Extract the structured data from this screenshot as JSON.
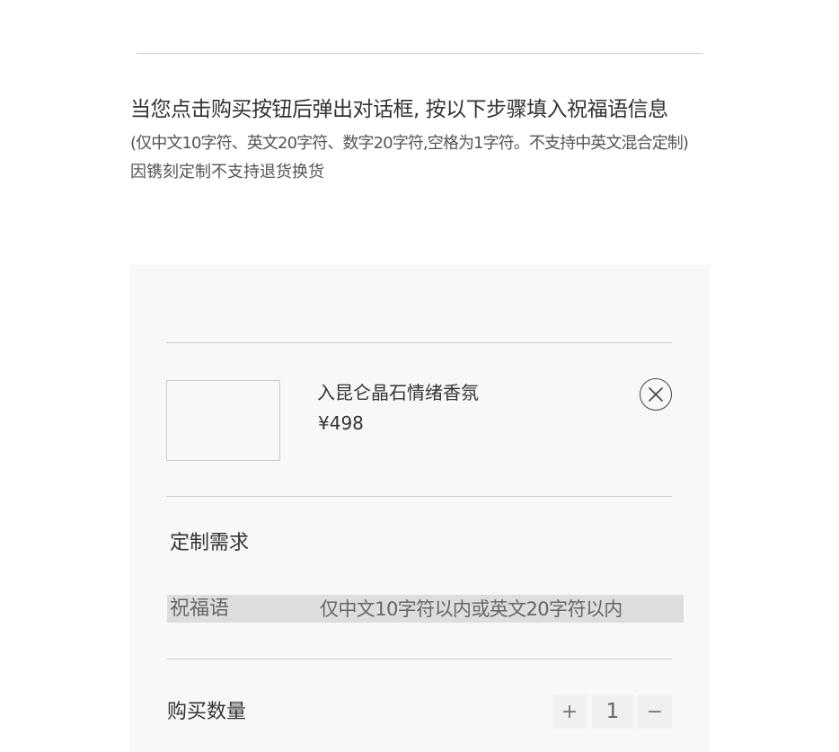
{
  "intro": {
    "title": "当您点击购买按钮后弹出对话框, 按以下步骤填入祝福语信息",
    "note": "(仅中文10字符、英文20字符、数字20字符,空格为1字符。不支持中英文混合定制)",
    "warning": "因镌刻定制不支持退货换货"
  },
  "product": {
    "name": "入昆仑晶石情绪香氛",
    "price": "¥498",
    "remove_icon": "close-circle-icon"
  },
  "customization": {
    "section_title": "定制需求",
    "blessing_label": "祝福语",
    "blessing_placeholder": "仅中文10字符以内或英文20字符以内",
    "blessing_value": ""
  },
  "quantity": {
    "label": "购买数量",
    "value": "1",
    "plus_label": "+",
    "minus_label": "−"
  },
  "colors": {
    "panel_background": "#f8f8f8",
    "input_background": "#dddddd",
    "text_primary": "#333333"
  }
}
